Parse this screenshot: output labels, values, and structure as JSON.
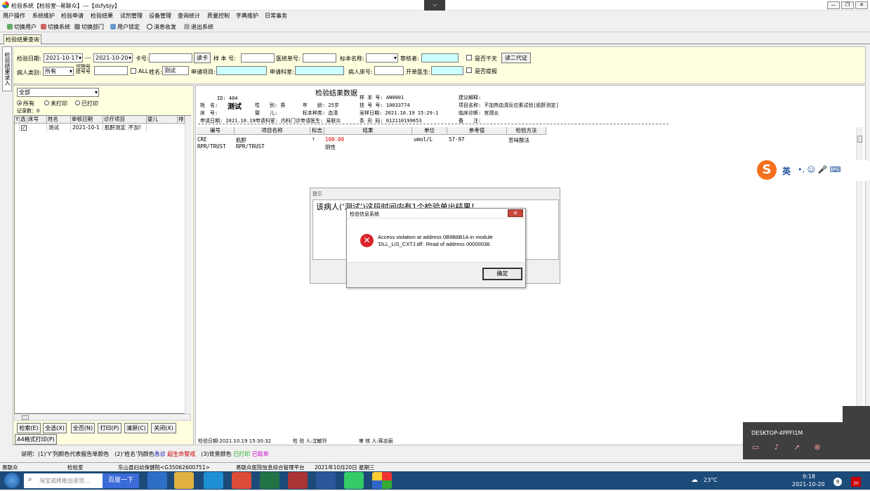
{
  "window": {
    "title": "检验系统【检验室--易联众】---【dsfybjy】",
    "dropdown_glyph": "⌵",
    "controls": [
      "—",
      "❐",
      "✕"
    ]
  },
  "menu": [
    "用户操作",
    "系统维护",
    "检验申请",
    "检验结果",
    "试剂管理",
    "设备管理",
    "查询统计",
    "质量控制",
    "字典维护",
    "日常事务"
  ],
  "toolbar": [
    "切换用户",
    "切换系统",
    "切换部门",
    "用户锁定",
    "消息收发",
    "退出系统"
  ],
  "tab": {
    "label": "检验结果查询"
  },
  "side_tab": {
    "label": "检验结果录入"
  },
  "filter": {
    "date_label": "检验日期:",
    "date_from": "2021-10-17",
    "date_sep": "---",
    "date_to": "2021-10-20",
    "card_label": "卡号:",
    "card_value": "",
    "read_card_btn": "读卡",
    "sample_label": "样 本 号:",
    "sample_value": "",
    "insurance_label": "医统单号:",
    "insurance_value": "",
    "specimen_label": "标本名称:",
    "specimen_value": "",
    "auditor_label": "审核者:",
    "auditor_value": "",
    "dry_label": "是否干天",
    "read_qr_btn": "读二代证",
    "patient_type_label": "病人类别:",
    "patient_type_value": "所有",
    "barcode_label": "住院号\n挂号号",
    "barcode_value": "",
    "all_label": "ALL",
    "name_label": "姓名:",
    "name_value": "测试",
    "request_item_label": "申请项目:",
    "request_item_value": "",
    "request_dept_label": "申请科室:",
    "request_dept_value": "",
    "bed_label": "病人床号:",
    "bed_value": "",
    "doctor_label": "开单医生:",
    "doctor_value": "",
    "report_label": "是否疫报"
  },
  "left": {
    "scope_value": "全部",
    "radios": [
      "所有",
      "未打印",
      "已打印"
    ],
    "record_count": "记录数：0",
    "columns": [
      "Y",
      "选",
      "床号",
      "姓名",
      "审核日期",
      "诊疗项目",
      "婴儿",
      "排"
    ],
    "rows": [
      {
        "y": "",
        "sel": "✓",
        "bed": "",
        "name": "测试",
        "date": "2021-10-1",
        "item": "肌酐测定",
        "baby": "不加!"
      }
    ],
    "buttons": [
      "检索(E)",
      "全选(X)",
      "全否(N)",
      "打印(P)",
      "清屏(C)",
      "关闭(X)"
    ],
    "a4_btn": "A4格式打印(P)"
  },
  "right": {
    "title": "检验结果数据",
    "info": {
      "id": "ID: 404",
      "name_k": "姓　名:",
      "name_v": "测试",
      "sex": "性　　别: 男",
      "age": "年　　龄: 25岁",
      "bed": "床　号:",
      "baby": "婴　　儿:",
      "specimen_type": "标本种类: 血清",
      "req_date": "申请日期: 2021.10.19申请科室: 内科门诊申请医生: 易联众",
      "sample_no": "样 本 号: AN0001",
      "reg_no": "挂 号 号: 10033774",
      "collect": "采样日期: 2021.10.19 15:29:1",
      "barcode": "条 形 码: 012110199653",
      "advice": "建议解释:",
      "item_name": "项目名称: 不加热血清反应素试验[肌酐测定]",
      "diagnosis": "临床诊断: 宫颈炎",
      "remark": "备　　注:"
    },
    "columns": [
      "编号",
      "项目名称",
      "标志",
      "结果",
      "单位",
      "参考值",
      "检验方法"
    ],
    "rows": [
      {
        "code": "CRE",
        "name": "肌酐",
        "flag": "↑",
        "result": "100.00",
        "unit": "umol/L",
        "ref": "57-97",
        "method": "苦味酸法"
      },
      {
        "code": "RPR/TRUST",
        "name": "RPR/TRUST",
        "flag": "",
        "result": "阴性",
        "unit": "",
        "ref": "",
        "method": ""
      }
    ],
    "footer": {
      "test_date": "检验日期:2021.10.19 15:30:32",
      "tester": "检 验 人:沈敏玲",
      "reviewer": "审 核 人:蒋志丽"
    }
  },
  "notice": {
    "title": "提示",
    "message": "该病人(‘测试’)这段时间内有1个检验单出结果！"
  },
  "error_dialog": {
    "title": "检验信息系统",
    "message_line1": "Access violation at address 0B9B8B1A in module",
    "message_line2": "'DLL_LIS_CXTJ.dll'. Read of address 00000038.",
    "ok": "确定"
  },
  "legend": {
    "prefix": "说明：(1)‘Y’列颜色代表报告单颜色　(2)‘姓名’列颜色",
    "urgent": "急诊",
    "critical": "超生命警戒",
    "bg": "　(3)背景颜色",
    "printed": "已打印",
    "voided": "已取单"
  },
  "status": [
    "易联众",
    "检验室",
    "东山县妇幼保健院<G35062600751>",
    "易联众医院信息综合管理平台",
    "2021年10月20日 星期三"
  ],
  "ime": {
    "mode": "英",
    "glyphs": "•, ☺ 🎤 ⌨"
  },
  "remote": {
    "host": "DESKTOP-4PPFI1M"
  },
  "taskbar": {
    "search_placeholder": "淘宝或拷推出退货...",
    "search_btn": "百度一下",
    "temp": "23°C",
    "time": "9:18",
    "date": "2021-10-20",
    "badge": "9",
    "notif": "30"
  }
}
